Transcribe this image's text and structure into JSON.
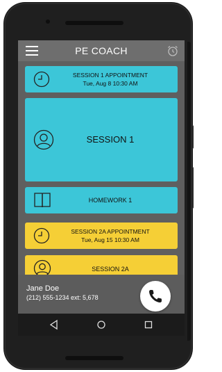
{
  "app": {
    "title": "PE COACH"
  },
  "cards": [
    {
      "line1": "SESSION 1 APPOINTMENT",
      "line2": "Tue, Aug 8 10:30 AM"
    },
    {
      "label": "SESSION 1"
    },
    {
      "label": "HOMEWORK 1"
    },
    {
      "line1": "SESSION 2A APPOINTMENT",
      "line2": "Tue, Aug 15 10:30 AM"
    },
    {
      "label": "SESSION 2A"
    }
  ],
  "contact": {
    "name": "Jane Doe",
    "phone": "(212) 555-1234 ext: 5,678"
  },
  "icons": {
    "menu": "hamburger-menu-icon",
    "alarm": "alarm-clock-icon",
    "clock": "clock-icon",
    "person": "person-icon",
    "book": "book-icon",
    "phone": "phone-icon",
    "back": "back-triangle-icon",
    "home": "home-circle-icon",
    "recents": "recents-square-icon"
  },
  "colors": {
    "cyan": "#3cc6d8",
    "yellow": "#f5cf36",
    "appbar": "#6e6e6e",
    "background": "#5f5f5f"
  }
}
